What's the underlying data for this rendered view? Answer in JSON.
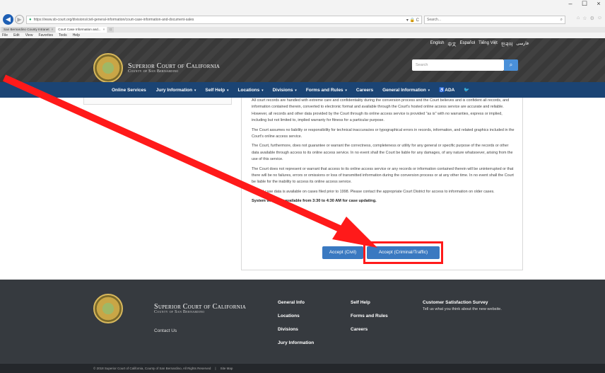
{
  "browser": {
    "url": "https://www.sb-court.org/divisions/civil-general-information/court-case-information-and-document-sales",
    "url_right": "▾ 🔒 C",
    "search_placeholder": "Search...",
    "window_controls": [
      "–",
      "☐",
      "×"
    ],
    "tabs": [
      {
        "label": "San Bernardino County Intranet",
        "close": "×"
      },
      {
        "label": "Court Case Information and...",
        "close": "×"
      }
    ],
    "menu": [
      "File",
      "Edit",
      "View",
      "Favorites",
      "Tools",
      "Help"
    ]
  },
  "header": {
    "languages": [
      "English",
      "中文",
      "Español",
      "Tiếng Việt",
      "한국어",
      "فارسی"
    ],
    "title": "Superior Court of California",
    "subtitle": "County of San Bernardino",
    "search_placeholder": "Search",
    "search_icon": "search-icon"
  },
  "nav": {
    "items": [
      {
        "label": "Online Services",
        "caret": ""
      },
      {
        "label": "Jury Information",
        "caret": "▾"
      },
      {
        "label": "Self Help",
        "caret": "▾"
      },
      {
        "label": "Locations",
        "caret": "▾"
      },
      {
        "label": "Divisions",
        "caret": "▾"
      },
      {
        "label": "Forms and Rules",
        "caret": "▾"
      },
      {
        "label": "Careers",
        "caret": ""
      },
      {
        "label": "General Information",
        "caret": "▾"
      },
      {
        "label": "♿ADA",
        "caret": ""
      },
      {
        "label": "🐦",
        "caret": ""
      }
    ]
  },
  "notice": {
    "paragraphs": [
      "All court records are handled with extreme care and confidentiality during the conversion process and the Court believes and is confident all records, and information contained therein, converted to electronic format and available through the Court's hosted online access service are accurate and reliable. However, all records and other data provided by the Court through its online access service is provided \"as is\" with no warranties, express or implied, including but not limited to, implied warranty for fitness for a particular purpose.",
      "The Court assumes no liability or responsibility for technical inaccuracies or typographical errors in records, information, and related graphics included in the Court's online access service.",
      "The Court, furthermore, does not guarantee or warrant the correctness, completeness or utility for any general or specific purpose of the records or other data available through access to its online access service. In no event shall the Court be liable for any damages, of any nature whatsoever, arising from the use of this service.",
      "The Court does not represent or warrant that access to its online access service or any records or information contained therein will be uninterrupted or that there will be no failures, errors or omissions or loss of transmitted information during the conversion process or at any other time. In no event shall the Court be liable for the inability to access its online access service.",
      "Limited case data is available on cases filed prior to 1998. Please contact the appropriate Court District for access to information on older cases."
    ],
    "warning": "System will be unavailable from 3:30 to 4:30 AM for case updating.",
    "btn_civil": "Accept (Civil)",
    "btn_criminal": "Accept (Criminal/Traffic)"
  },
  "footer": {
    "title": "Superior Court of California",
    "subtitle": "County of San Bernardino",
    "contact": "Contact Us",
    "col1": [
      "General Info",
      "Locations",
      "Divisions",
      "Jury Information"
    ],
    "col2": [
      "Self Help",
      "Forms and Rules",
      "Careers"
    ],
    "survey_title": "Customer Satisfaction Survey",
    "survey_desc": "Tell us what you think about the new website.",
    "copyright": "© 2018 Superior Court of California, County of San Bernardino, All Rights Reserved",
    "separator": "|",
    "sitemap": "Site Map"
  },
  "annotation": {
    "arrow_color": "#ff1a1a",
    "highlight_color": "#ff1a1a"
  }
}
